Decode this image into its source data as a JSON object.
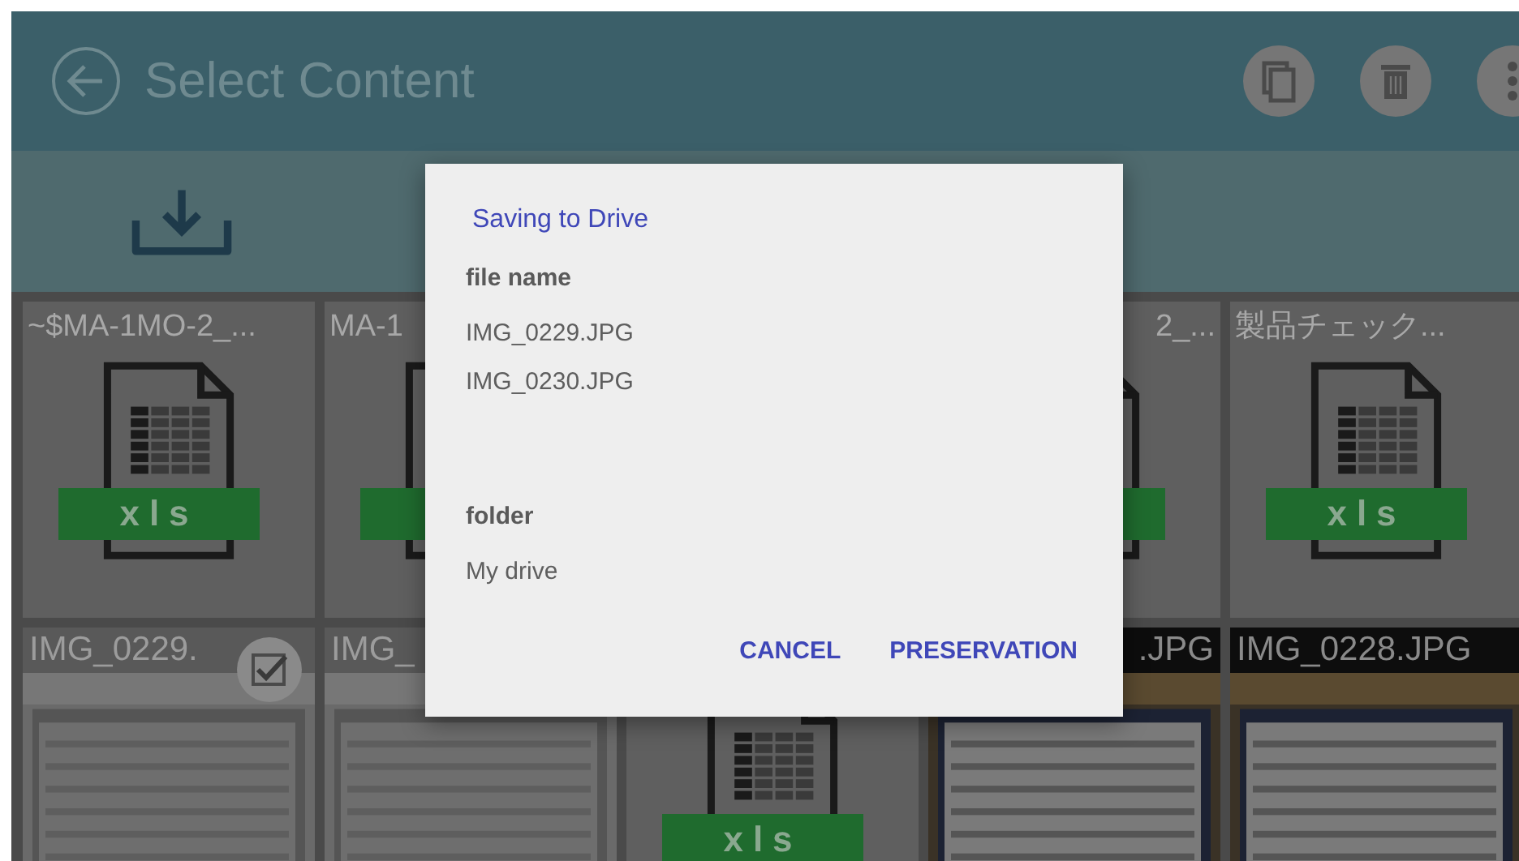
{
  "app_bar": {
    "title": "Select Content"
  },
  "tiles": [
    {
      "kind": "xls",
      "label": "~$MA-1MO-2_...",
      "badge": "xls"
    },
    {
      "kind": "xls",
      "label": "MA-1"
    },
    {
      "kind": "xls",
      "label": "2_...",
      "cut_left": true
    },
    {
      "kind": "xls",
      "label": "製品チェック...",
      "badge": "xls"
    },
    {
      "label": "IMG_0229.",
      "selected": true,
      "checkbox": true
    },
    {
      "label": "IMG_",
      "selected": true
    },
    {
      "kind": "xls",
      "badge": "xls"
    },
    {
      "label": ".JPG",
      "cut_left": true,
      "selected": false
    },
    {
      "label": "IMG_0228.JPG",
      "selected": false
    }
  ],
  "dialog": {
    "title": "Saving to Drive",
    "file_label": "file name",
    "files": [
      "IMG_0229.JPG",
      "IMG_0230.JPG"
    ],
    "folder_label": "folder",
    "folder": "My drive",
    "buttons": [
      "CANCEL",
      "PRESERVATION"
    ]
  }
}
